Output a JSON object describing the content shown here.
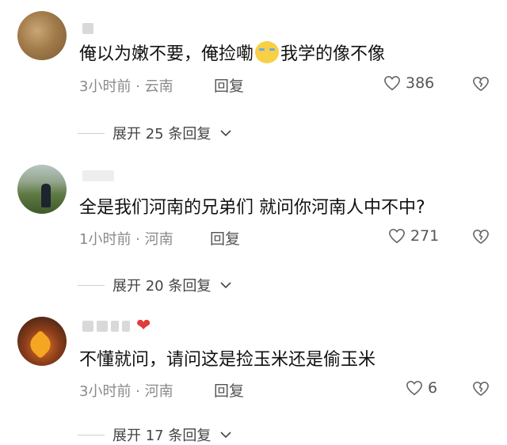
{
  "comments": [
    {
      "text_before": "俺以为嫩不要，俺捡嘞",
      "text_after": "我学的像不像",
      "time": "3小时前",
      "location": "云南",
      "reply_label": "回复",
      "likes": "386",
      "expand_label": "展开 25 条回复"
    },
    {
      "text": "全是我们河南的兄弟们  就问你河南人中不中?",
      "time": "1小时前",
      "location": "河南",
      "reply_label": "回复",
      "likes": "271",
      "expand_label": "展开 20 条回复"
    },
    {
      "text": "不懂就问，请问这是捡玉米还是偷玉米",
      "time": "3小时前",
      "location": "河南",
      "reply_label": "回复",
      "likes": "6",
      "expand_label": "展开 17 条回复"
    }
  ],
  "meta_separator": " · ",
  "icons": {
    "like": "heart-outline-icon",
    "dislike": "broken-heart-icon",
    "expand": "chevron-down-icon",
    "emoji": "laughing-crying-emoji-icon",
    "badge": "red-heart-icon"
  },
  "colors": {
    "text": "#111111",
    "meta": "#8a8a8a",
    "badge": "#e23b3b"
  }
}
